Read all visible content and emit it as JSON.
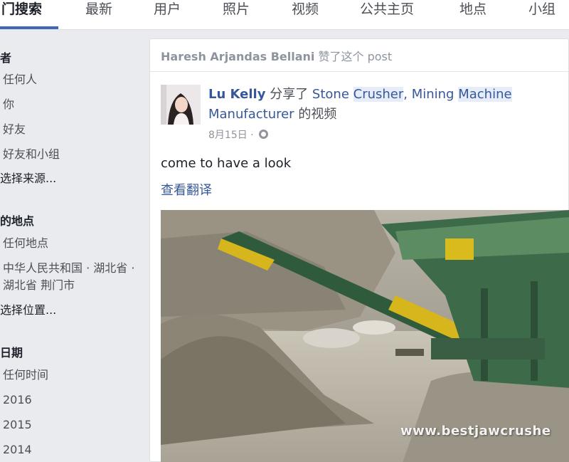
{
  "tabs": [
    {
      "label": "门搜索",
      "active": true
    },
    {
      "label": "最新",
      "active": false
    },
    {
      "label": "用户",
      "active": false
    },
    {
      "label": "照片",
      "active": false
    },
    {
      "label": "视频",
      "active": false
    },
    {
      "label": "公共主页",
      "active": false
    },
    {
      "label": "地点",
      "active": false
    },
    {
      "label": "小组",
      "active": false
    }
  ],
  "sidebar": {
    "author_section": {
      "heading": "者",
      "items": [
        "任何人",
        "你",
        "好友",
        "好友和小组"
      ],
      "choose": "选择来源..."
    },
    "location_section": {
      "heading": "的地点",
      "items": [
        "任何地点",
        "中华人民共和国 · 湖北省 · 湖北省 荆门市"
      ],
      "choose": "选择位置..."
    },
    "date_section": {
      "heading": "日期",
      "items": [
        "任何时间",
        "2016",
        "2015",
        "2014"
      ]
    }
  },
  "post": {
    "context_actor": "Haresh Arjandas Bellani",
    "context_text": " 赞了这个 post",
    "author": "Lu Kelly",
    "shared_text": " 分享了 ",
    "page_part1": "Stone ",
    "page_part2": "Crusher",
    "page_part3": ", Mining ",
    "page_part4": "Machine",
    "page_part5": "Manufacturer",
    "shared_suffix": " 的视频",
    "date": "8月15日 · ",
    "body": "come to have a look",
    "translate": "查看翻译",
    "video_watermark": "www.bestjawcrushe"
  },
  "colors": {
    "link": "#365899",
    "accent": "#4267b2",
    "page_bg": "#e9ebee"
  },
  "icons": {
    "privacy": "globe-icon"
  }
}
